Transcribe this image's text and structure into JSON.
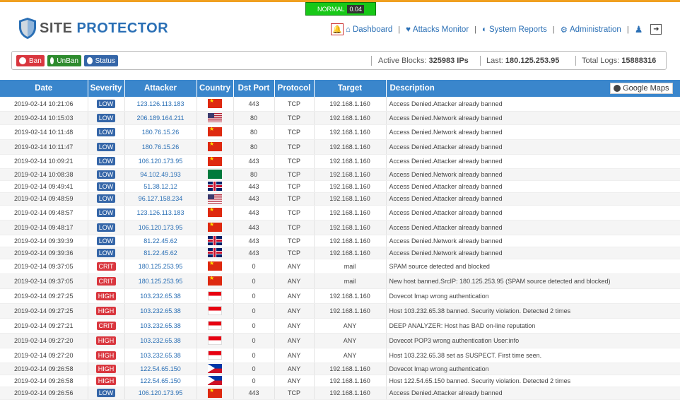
{
  "status": {
    "level": "NORMAL",
    "value": "0.04"
  },
  "brand": {
    "word1": "SITE",
    "word2": "PROTECTOR"
  },
  "nav": {
    "dashboard": "Dashboard",
    "attacks_monitor": "Attacks Monitor",
    "system_reports": "System Reports",
    "administration": "Administration",
    "separator": "|"
  },
  "actions": {
    "ban": "Ban",
    "unban": "UnBan",
    "status": "Status"
  },
  "stats": {
    "active_blocks_label": "Active Blocks:",
    "active_blocks_value": "325983 IPs",
    "last_label": "Last:",
    "last_value": "180.125.253.95",
    "total_logs_label": "Total Logs:",
    "total_logs_value": "15888316"
  },
  "colors": {
    "accent": "#3a86cc",
    "low": "#3566a8",
    "high": "#d9363e",
    "level_ok": "#18c818"
  },
  "table": {
    "headers": {
      "date": "Date",
      "severity": "Severity",
      "attacker": "Attacker",
      "country": "Country",
      "dst_port": "Dst Port",
      "protocol": "Protocol",
      "target": "Target",
      "description": "Description"
    },
    "google_maps": "Google Maps",
    "rows": [
      {
        "date": "2019-02-14 10:21:06",
        "severity": "LOW",
        "sev": "low",
        "attacker": "123.126.113.183",
        "flag": "cn",
        "port": "443",
        "protocol": "TCP",
        "target": "192.168.1.160",
        "desc": "Access Denied.Attacker already banned"
      },
      {
        "date": "2019-02-14 10:15:03",
        "severity": "LOW",
        "sev": "low",
        "attacker": "206.189.164.211",
        "flag": "us",
        "port": "80",
        "protocol": "TCP",
        "target": "192.168.1.160",
        "desc": "Access Denied.Network already banned"
      },
      {
        "date": "2019-02-14 10:11:48",
        "severity": "LOW",
        "sev": "low",
        "attacker": "180.76.15.26",
        "flag": "cn",
        "port": "80",
        "protocol": "TCP",
        "target": "192.168.1.160",
        "desc": "Access Denied.Network already banned"
      },
      {
        "date": "2019-02-14 10:11:47",
        "severity": "LOW",
        "sev": "low",
        "attacker": "180.76.15.26",
        "flag": "cn",
        "port": "80",
        "protocol": "TCP",
        "target": "192.168.1.160",
        "desc": "Access Denied.Attacker already banned"
      },
      {
        "date": "2019-02-14 10:09:21",
        "severity": "LOW",
        "sev": "low",
        "attacker": "106.120.173.95",
        "flag": "cn",
        "port": "443",
        "protocol": "TCP",
        "target": "192.168.1.160",
        "desc": "Access Denied.Attacker already banned"
      },
      {
        "date": "2019-02-14 10:08:38",
        "severity": "LOW",
        "sev": "low",
        "attacker": "94.102.49.193",
        "flag": "sc",
        "port": "80",
        "protocol": "TCP",
        "target": "192.168.1.160",
        "desc": "Access Denied.Network already banned"
      },
      {
        "date": "2019-02-14 09:49:41",
        "severity": "LOW",
        "sev": "low",
        "attacker": "51.38.12.12",
        "flag": "gb",
        "port": "443",
        "protocol": "TCP",
        "target": "192.168.1.160",
        "desc": "Access Denied.Attacker already banned"
      },
      {
        "date": "2019-02-14 09:48:59",
        "severity": "LOW",
        "sev": "low",
        "attacker": "96.127.158.234",
        "flag": "us",
        "port": "443",
        "protocol": "TCP",
        "target": "192.168.1.160",
        "desc": "Access Denied.Attacker already banned"
      },
      {
        "date": "2019-02-14 09:48:57",
        "severity": "LOW",
        "sev": "low",
        "attacker": "123.126.113.183",
        "flag": "cn",
        "port": "443",
        "protocol": "TCP",
        "target": "192.168.1.160",
        "desc": "Access Denied.Attacker already banned"
      },
      {
        "date": "2019-02-14 09:48:17",
        "severity": "LOW",
        "sev": "low",
        "attacker": "106.120.173.95",
        "flag": "cn",
        "port": "443",
        "protocol": "TCP",
        "target": "192.168.1.160",
        "desc": "Access Denied.Attacker already banned"
      },
      {
        "date": "2019-02-14 09:39:39",
        "severity": "LOW",
        "sev": "low",
        "attacker": "81.22.45.62",
        "flag": "gb",
        "port": "443",
        "protocol": "TCP",
        "target": "192.168.1.160",
        "desc": "Access Denied.Network already banned"
      },
      {
        "date": "2019-02-14 09:39:36",
        "severity": "LOW",
        "sev": "low",
        "attacker": "81.22.45.62",
        "flag": "gb",
        "port": "443",
        "protocol": "TCP",
        "target": "192.168.1.160",
        "desc": "Access Denied.Network already banned"
      },
      {
        "date": "2019-02-14 09:37:05",
        "severity": "CRIT",
        "sev": "crit",
        "attacker": "180.125.253.95",
        "flag": "cn",
        "port": "0",
        "protocol": "ANY",
        "target": "mail",
        "desc": "SPAM source detected and blocked"
      },
      {
        "date": "2019-02-14 09:37:05",
        "severity": "CRIT",
        "sev": "crit",
        "attacker": "180.125.253.95",
        "flag": "cn",
        "port": "0",
        "protocol": "ANY",
        "target": "mail",
        "desc": "New host banned.SrcIP: 180.125.253.95 (SPAM source detected and blocked)"
      },
      {
        "date": "2019-02-14 09:27:25",
        "severity": "HIGH",
        "sev": "high",
        "attacker": "103.232.65.38",
        "flag": "id",
        "port": "0",
        "protocol": "ANY",
        "target": "192.168.1.160",
        "desc": "Dovecot Imap wrong authentication"
      },
      {
        "date": "2019-02-14 09:27:25",
        "severity": "HIGH",
        "sev": "high",
        "attacker": "103.232.65.38",
        "flag": "id",
        "port": "0",
        "protocol": "ANY",
        "target": "192.168.1.160",
        "desc": "Host 103.232.65.38 banned. Security violation. Detected 2 times"
      },
      {
        "date": "2019-02-14 09:27:21",
        "severity": "CRIT",
        "sev": "crit",
        "attacker": "103.232.65.38",
        "flag": "id",
        "port": "0",
        "protocol": "ANY",
        "target": "ANY",
        "desc": "DEEP ANALYZER: Host has BAD on-line reputation"
      },
      {
        "date": "2019-02-14 09:27:20",
        "severity": "HIGH",
        "sev": "high",
        "attacker": "103.232.65.38",
        "flag": "id",
        "port": "0",
        "protocol": "ANY",
        "target": "ANY",
        "desc": "Dovecot POP3 wrong authentication User:info"
      },
      {
        "date": "2019-02-14 09:27:20",
        "severity": "HIGH",
        "sev": "high",
        "attacker": "103.232.65.38",
        "flag": "id",
        "port": "0",
        "protocol": "ANY",
        "target": "ANY",
        "desc": "Host 103.232.65.38 set as SUSPECT. First time seen."
      },
      {
        "date": "2019-02-14 09:26:58",
        "severity": "HIGH",
        "sev": "high",
        "attacker": "122.54.65.150",
        "flag": "ph",
        "port": "0",
        "protocol": "ANY",
        "target": "192.168.1.160",
        "desc": "Dovecot Imap wrong authentication"
      },
      {
        "date": "2019-02-14 09:26:58",
        "severity": "HIGH",
        "sev": "high",
        "attacker": "122.54.65.150",
        "flag": "ph",
        "port": "0",
        "protocol": "ANY",
        "target": "192.168.1.160",
        "desc": "Host 122.54.65.150 banned. Security violation. Detected 2 times"
      },
      {
        "date": "2019-02-14 09:26:56",
        "severity": "LOW",
        "sev": "low",
        "attacker": "106.120.173.95",
        "flag": "cn",
        "port": "443",
        "protocol": "TCP",
        "target": "192.168.1.160",
        "desc": "Access Denied.Attacker already banned"
      }
    ]
  }
}
